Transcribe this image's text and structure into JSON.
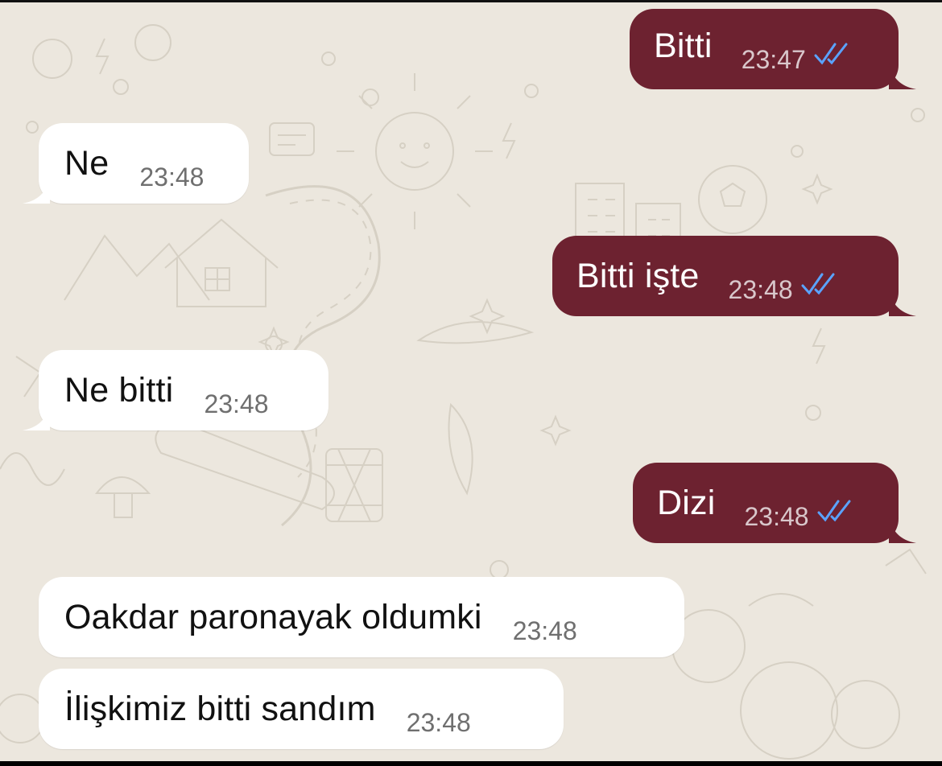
{
  "colors": {
    "background": "#ece7de",
    "incoming_bubble": "#ffffff",
    "outgoing_bubble": "#6d2230",
    "read_ticks": "#5aa3ff"
  },
  "messages": [
    {
      "direction": "outgoing",
      "text": "Bitti",
      "time": "23:47",
      "status": "read"
    },
    {
      "direction": "incoming",
      "text": "Ne",
      "time": "23:48"
    },
    {
      "direction": "outgoing",
      "text": "Bitti işte",
      "time": "23:48",
      "status": "read"
    },
    {
      "direction": "incoming",
      "text": "Ne bitti",
      "time": "23:48"
    },
    {
      "direction": "outgoing",
      "text": "Dizi",
      "time": "23:48",
      "status": "read"
    },
    {
      "direction": "incoming",
      "text": "Oakdar paronayak oldumki",
      "time": "23:48"
    },
    {
      "direction": "incoming",
      "text": "İlişkimiz bitti sandım",
      "time": "23:48"
    }
  ]
}
